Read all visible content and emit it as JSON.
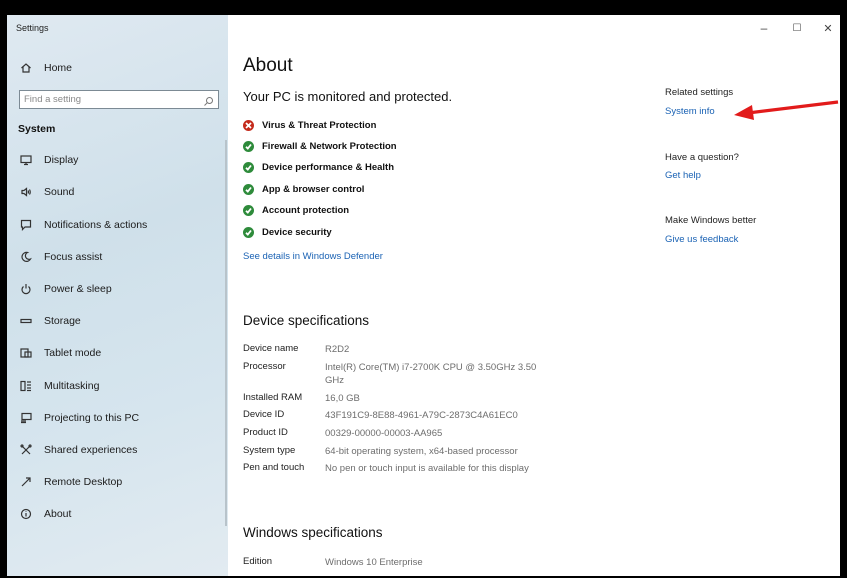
{
  "window": {
    "title": "Settings",
    "controls": [
      "–",
      "☐",
      "✕"
    ]
  },
  "sidebar": {
    "home_label": "Home",
    "search": {
      "placeholder": "Find a setting"
    },
    "section": "System",
    "items": [
      {
        "label": "Display",
        "icon": "display-icon"
      },
      {
        "label": "Sound",
        "icon": "sound-icon"
      },
      {
        "label": "Notifications & actions",
        "icon": "notifications-icon"
      },
      {
        "label": "Focus assist",
        "icon": "focus-assist-icon"
      },
      {
        "label": "Power & sleep",
        "icon": "power-icon"
      },
      {
        "label": "Storage",
        "icon": "storage-icon"
      },
      {
        "label": "Tablet mode",
        "icon": "tablet-mode-icon"
      },
      {
        "label": "Multitasking",
        "icon": "multitasking-icon"
      },
      {
        "label": "Projecting to this PC",
        "icon": "projecting-icon"
      },
      {
        "label": "Shared experiences",
        "icon": "shared-experiences-icon"
      },
      {
        "label": "Remote Desktop",
        "icon": "remote-desktop-icon"
      },
      {
        "label": "About",
        "icon": "about-icon"
      }
    ]
  },
  "main": {
    "title": "About",
    "protection_heading": "Your PC is monitored and protected.",
    "protection_items": [
      {
        "label": "Virus & Threat Protection",
        "status": "error"
      },
      {
        "label": "Firewall & Network Protection",
        "status": "ok"
      },
      {
        "label": "Device performance & Health",
        "status": "ok"
      },
      {
        "label": "App & browser control",
        "status": "ok"
      },
      {
        "label": "Account protection",
        "status": "ok"
      },
      {
        "label": "Device security",
        "status": "ok"
      }
    ],
    "defender_link": "See details in Windows Defender",
    "device_specs": {
      "heading": "Device specifications",
      "rows": [
        {
          "key": "Device name",
          "value": "R2D2"
        },
        {
          "key": "Processor",
          "value": "Intel(R) Core(TM) i7-2700K CPU @ 3.50GHz   3.50 GHz"
        },
        {
          "key": "Installed RAM",
          "value": "16,0 GB"
        },
        {
          "key": "Device ID",
          "value": "43F191C9-8E88-4961-A79C-2873C4A61EC0"
        },
        {
          "key": "Product ID",
          "value": "00329-00000-00003-AA965"
        },
        {
          "key": "System type",
          "value": "64-bit operating system, x64-based processor"
        },
        {
          "key": "Pen and touch",
          "value": "No pen or touch input is available for this display"
        }
      ]
    },
    "windows_specs": {
      "heading": "Windows specifications",
      "rows": [
        {
          "key": "Edition",
          "value": "Windows 10 Enterprise"
        }
      ]
    }
  },
  "right": {
    "related_heading": "Related settings",
    "system_info_link": "System info",
    "question_heading": "Have a question?",
    "help_link": "Get help",
    "better_heading": "Make Windows better",
    "feedback_link": "Give us feedback"
  },
  "colors": {
    "accent_link": "#1a62b4",
    "status_ok": "#2e8b3b",
    "status_error": "#c42b1c",
    "annotation_arrow": "#e21b1b"
  }
}
